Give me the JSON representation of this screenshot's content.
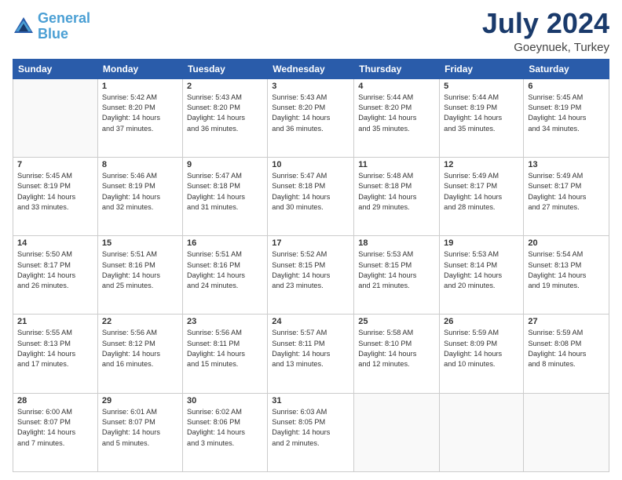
{
  "header": {
    "logo_line1": "General",
    "logo_line2": "Blue",
    "month": "July 2024",
    "location": "Goeynuek, Turkey"
  },
  "weekdays": [
    "Sunday",
    "Monday",
    "Tuesday",
    "Wednesday",
    "Thursday",
    "Friday",
    "Saturday"
  ],
  "weeks": [
    [
      {
        "day": "",
        "info": ""
      },
      {
        "day": "1",
        "info": "Sunrise: 5:42 AM\nSunset: 8:20 PM\nDaylight: 14 hours\nand 37 minutes."
      },
      {
        "day": "2",
        "info": "Sunrise: 5:43 AM\nSunset: 8:20 PM\nDaylight: 14 hours\nand 36 minutes."
      },
      {
        "day": "3",
        "info": "Sunrise: 5:43 AM\nSunset: 8:20 PM\nDaylight: 14 hours\nand 36 minutes."
      },
      {
        "day": "4",
        "info": "Sunrise: 5:44 AM\nSunset: 8:20 PM\nDaylight: 14 hours\nand 35 minutes."
      },
      {
        "day": "5",
        "info": "Sunrise: 5:44 AM\nSunset: 8:19 PM\nDaylight: 14 hours\nand 35 minutes."
      },
      {
        "day": "6",
        "info": "Sunrise: 5:45 AM\nSunset: 8:19 PM\nDaylight: 14 hours\nand 34 minutes."
      }
    ],
    [
      {
        "day": "7",
        "info": "Sunrise: 5:45 AM\nSunset: 8:19 PM\nDaylight: 14 hours\nand 33 minutes."
      },
      {
        "day": "8",
        "info": "Sunrise: 5:46 AM\nSunset: 8:19 PM\nDaylight: 14 hours\nand 32 minutes."
      },
      {
        "day": "9",
        "info": "Sunrise: 5:47 AM\nSunset: 8:18 PM\nDaylight: 14 hours\nand 31 minutes."
      },
      {
        "day": "10",
        "info": "Sunrise: 5:47 AM\nSunset: 8:18 PM\nDaylight: 14 hours\nand 30 minutes."
      },
      {
        "day": "11",
        "info": "Sunrise: 5:48 AM\nSunset: 8:18 PM\nDaylight: 14 hours\nand 29 minutes."
      },
      {
        "day": "12",
        "info": "Sunrise: 5:49 AM\nSunset: 8:17 PM\nDaylight: 14 hours\nand 28 minutes."
      },
      {
        "day": "13",
        "info": "Sunrise: 5:49 AM\nSunset: 8:17 PM\nDaylight: 14 hours\nand 27 minutes."
      }
    ],
    [
      {
        "day": "14",
        "info": "Sunrise: 5:50 AM\nSunset: 8:17 PM\nDaylight: 14 hours\nand 26 minutes."
      },
      {
        "day": "15",
        "info": "Sunrise: 5:51 AM\nSunset: 8:16 PM\nDaylight: 14 hours\nand 25 minutes."
      },
      {
        "day": "16",
        "info": "Sunrise: 5:51 AM\nSunset: 8:16 PM\nDaylight: 14 hours\nand 24 minutes."
      },
      {
        "day": "17",
        "info": "Sunrise: 5:52 AM\nSunset: 8:15 PM\nDaylight: 14 hours\nand 23 minutes."
      },
      {
        "day": "18",
        "info": "Sunrise: 5:53 AM\nSunset: 8:15 PM\nDaylight: 14 hours\nand 21 minutes."
      },
      {
        "day": "19",
        "info": "Sunrise: 5:53 AM\nSunset: 8:14 PM\nDaylight: 14 hours\nand 20 minutes."
      },
      {
        "day": "20",
        "info": "Sunrise: 5:54 AM\nSunset: 8:13 PM\nDaylight: 14 hours\nand 19 minutes."
      }
    ],
    [
      {
        "day": "21",
        "info": "Sunrise: 5:55 AM\nSunset: 8:13 PM\nDaylight: 14 hours\nand 17 minutes."
      },
      {
        "day": "22",
        "info": "Sunrise: 5:56 AM\nSunset: 8:12 PM\nDaylight: 14 hours\nand 16 minutes."
      },
      {
        "day": "23",
        "info": "Sunrise: 5:56 AM\nSunset: 8:11 PM\nDaylight: 14 hours\nand 15 minutes."
      },
      {
        "day": "24",
        "info": "Sunrise: 5:57 AM\nSunset: 8:11 PM\nDaylight: 14 hours\nand 13 minutes."
      },
      {
        "day": "25",
        "info": "Sunrise: 5:58 AM\nSunset: 8:10 PM\nDaylight: 14 hours\nand 12 minutes."
      },
      {
        "day": "26",
        "info": "Sunrise: 5:59 AM\nSunset: 8:09 PM\nDaylight: 14 hours\nand 10 minutes."
      },
      {
        "day": "27",
        "info": "Sunrise: 5:59 AM\nSunset: 8:08 PM\nDaylight: 14 hours\nand 8 minutes."
      }
    ],
    [
      {
        "day": "28",
        "info": "Sunrise: 6:00 AM\nSunset: 8:07 PM\nDaylight: 14 hours\nand 7 minutes."
      },
      {
        "day": "29",
        "info": "Sunrise: 6:01 AM\nSunset: 8:07 PM\nDaylight: 14 hours\nand 5 minutes."
      },
      {
        "day": "30",
        "info": "Sunrise: 6:02 AM\nSunset: 8:06 PM\nDaylight: 14 hours\nand 3 minutes."
      },
      {
        "day": "31",
        "info": "Sunrise: 6:03 AM\nSunset: 8:05 PM\nDaylight: 14 hours\nand 2 minutes."
      },
      {
        "day": "",
        "info": ""
      },
      {
        "day": "",
        "info": ""
      },
      {
        "day": "",
        "info": ""
      }
    ]
  ]
}
